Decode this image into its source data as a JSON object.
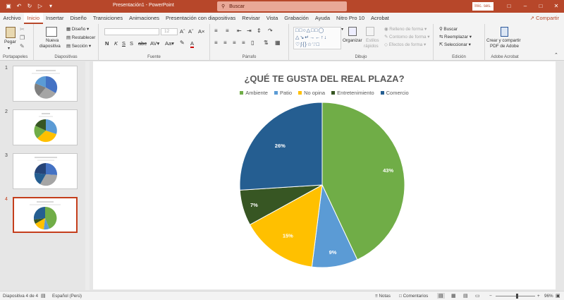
{
  "window": {
    "title": "Presentación1 - PowerPoint",
    "search_placeholder": "Buscar",
    "signin_label": "Inic. ses."
  },
  "menu": {
    "tabs": [
      "Archivo",
      "Inicio",
      "Insertar",
      "Diseño",
      "Transiciones",
      "Animaciones",
      "Presentación con diapositivas",
      "Revisar",
      "Vista",
      "Grabación",
      "Ayuda",
      "Nitro Pro 10",
      "Acrobat"
    ],
    "active_tab": "Inicio",
    "share_label": "Compartir"
  },
  "ribbon": {
    "clipboard": {
      "paste_label": "Pegar",
      "group_label": "Portapapeles"
    },
    "slides": {
      "new_slide_label_1": "Nueva",
      "new_slide_label_2": "diapositiva",
      "layout_label": "Diseño",
      "reset_label": "Restablecer",
      "section_label": "Sección",
      "group_label": "Diapositivas"
    },
    "font": {
      "size_value": "12",
      "group_label": "Fuente"
    },
    "paragraph": {
      "group_label": "Párrafo"
    },
    "drawing": {
      "arrange_label": "Organizar",
      "quick_styles_label_1": "Estilos",
      "quick_styles_label_2": "rápidos",
      "shape_fill_label": "Relleno de forma",
      "shape_outline_label": "Contorno de forma",
      "shape_effects_label": "Efectos de forma",
      "group_label": "Dibujo"
    },
    "editing": {
      "find_label": "Buscar",
      "replace_label": "Reemplazar",
      "select_label": "Seleccionar",
      "group_label": "Edición"
    },
    "adobe": {
      "create_label_1": "Crear y compartir",
      "create_label_2": "PDF de Adobe",
      "group_label": "Adobe Acrobat"
    }
  },
  "slides_panel": {
    "items": [
      {
        "number": "1",
        "active": false
      },
      {
        "number": "2",
        "active": false
      },
      {
        "number": "3",
        "active": false
      },
      {
        "number": "4",
        "active": true
      }
    ]
  },
  "status": {
    "slide_info": "Diapositiva 4 de 4",
    "language": "Español (Perú)",
    "notes_label": "Notas",
    "comments_label": "Comentarios",
    "zoom_value": "96%"
  },
  "colors": {
    "accent": "#b7472a",
    "ambiente": "#70ad47",
    "patio": "#5b9bd5",
    "no_opina": "#ffc000",
    "entretenimiento": "#375623",
    "comercio": "#255e91"
  },
  "chart_data": {
    "type": "pie",
    "title": "¿QUÉ TE GUSTA DEL REAL PLAZA?",
    "categories": [
      "Ambiente",
      "Patio",
      "No opina",
      "Entretenimiento",
      "Comercio"
    ],
    "values": [
      43,
      9,
      15,
      7,
      26
    ],
    "labels": [
      "43%",
      "9%",
      "15%",
      "7%",
      "26%"
    ],
    "colors": [
      "#70ad47",
      "#5b9bd5",
      "#ffc000",
      "#375623",
      "#255e91"
    ],
    "legend_position": "top"
  }
}
